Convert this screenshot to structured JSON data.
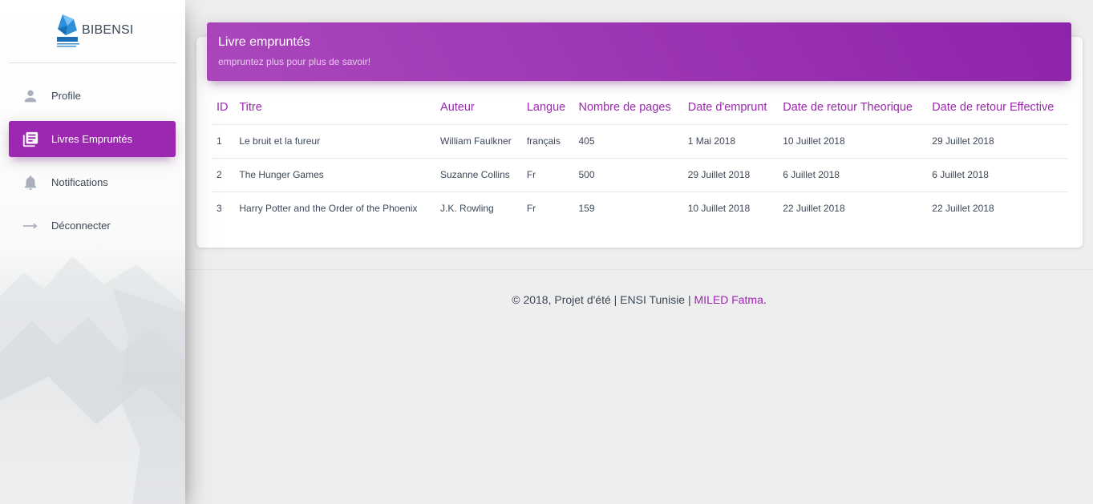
{
  "app": {
    "name": "BIBENSI",
    "logo_text": "ENSI"
  },
  "sidebar": {
    "items": [
      {
        "label": "Profile",
        "icon": "person-icon",
        "active": false
      },
      {
        "label": "Livres Empruntés",
        "icon": "library-books-icon",
        "active": true
      },
      {
        "label": "Notifications",
        "icon": "bell-icon",
        "active": false
      },
      {
        "label": "Déconnecter",
        "icon": "arrow-right-icon",
        "active": false
      }
    ]
  },
  "card": {
    "title": "Livre empruntés",
    "subtitle": "empruntez plus pour plus de savoir!"
  },
  "table": {
    "headers": [
      "ID",
      "Titre",
      "Auteur",
      "Langue",
      "Nombre de pages",
      "Date d'emprunt",
      "Date de retour Theorique",
      "Date de retour Effective"
    ],
    "rows": [
      [
        "1",
        "Le bruit et la fureur",
        "William Faulkner",
        "français",
        "405",
        "1 Mai 2018",
        "10 Juillet 2018",
        "29 Juillet 2018"
      ],
      [
        "2",
        "The Hunger Games",
        "Suzanne Collins",
        "Fr",
        "500",
        "29 Juillet 2018",
        "6 Juillet 2018",
        "6 Juillet 2018"
      ],
      [
        "3",
        "Harry Potter and the Order of the Phoenix",
        "J.K. Rowling",
        "Fr",
        "159",
        "10 Juillet 2018",
        "22 Juillet 2018",
        "22 Juillet 2018"
      ]
    ]
  },
  "footer": {
    "text": "© 2018, Projet d'été | ENSI Tunisie | ",
    "author": "MILED Fatma",
    "suffix": "."
  },
  "colors": {
    "accent": "#9c27b0",
    "background": "#eeeeee",
    "text": "#3c4858"
  }
}
